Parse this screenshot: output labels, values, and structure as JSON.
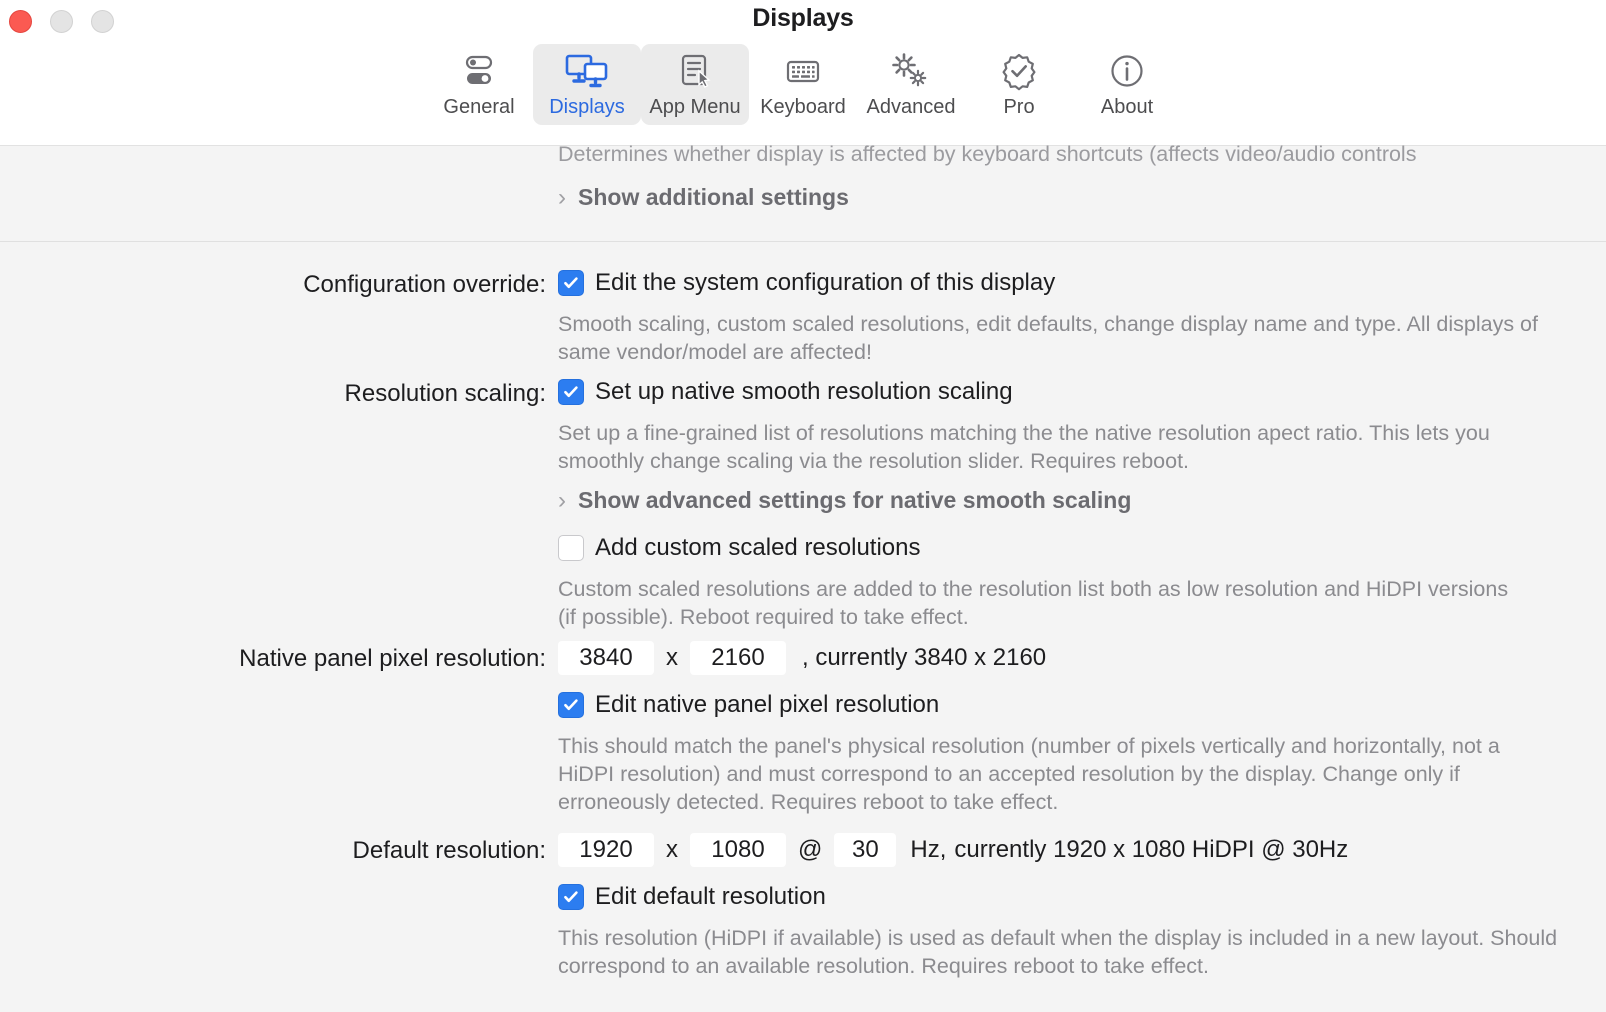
{
  "window": {
    "title": "Displays",
    "controls": [
      {
        "name": "close",
        "color": "#fb5a52"
      },
      {
        "name": "minimize",
        "color": "#e4e4e4"
      },
      {
        "name": "zoom",
        "color": "#e4e4e4"
      }
    ]
  },
  "toolbar": {
    "items": [
      {
        "label": "General",
        "icon": "toggles-icon",
        "state": "normal"
      },
      {
        "label": "Displays",
        "icon": "displays-icon",
        "state": "active"
      },
      {
        "label": "App Menu",
        "icon": "app-menu-icon",
        "state": "selected"
      },
      {
        "label": "Keyboard",
        "icon": "keyboard-icon",
        "state": "normal"
      },
      {
        "label": "Advanced",
        "icon": "gears-icon",
        "state": "normal"
      },
      {
        "label": "Pro",
        "icon": "badge-check-icon",
        "state": "normal"
      },
      {
        "label": "About",
        "icon": "info-circle-icon",
        "state": "normal"
      }
    ],
    "accent_color": "#2c6ae0",
    "selected_bg": "#ebebeb"
  },
  "content": {
    "clipped_description": "Determines whether display is affected by keyboard shortcuts (affects video/audio controls",
    "show_additional_settings": "Show additional settings",
    "chevron": "›",
    "configuration_override": {
      "label": "Configuration override:",
      "checkbox_label": "Edit the system configuration of this display",
      "checked": true,
      "help": "Smooth scaling, custom scaled resolutions, edit defaults, change display name and type. All displays of same vendor/model are affected!"
    },
    "resolution_scaling": {
      "label": "Resolution scaling:",
      "checkbox_label": "Set up native smooth resolution scaling",
      "checked": true,
      "help": "Set up a fine-grained list of resolutions matching the the native resolution apect ratio. This lets you smoothly change scaling via the resolution slider. Requires reboot.",
      "advanced_disclosure": "Show advanced settings for native smooth scaling"
    },
    "custom_scaled": {
      "checkbox_label": "Add custom scaled resolutions",
      "checked": false,
      "help": "Custom scaled resolutions are added to the resolution list both as low resolution and HiDPI versions (if possible). Reboot required to take effect."
    },
    "native_panel": {
      "label": "Native panel pixel resolution:",
      "width": "3840",
      "height": "2160",
      "separator": "x",
      "trailing": ", currently 3840 x 2160",
      "checkbox_label": "Edit native panel pixel resolution",
      "checked": true,
      "help": "This should match the panel's physical resolution (number of pixels vertically and horizontally, not a HiDPI resolution) and must correspond to an accepted resolution by the display. Change only if erroneously detected. Requires reboot to take effect."
    },
    "default_resolution": {
      "label": "Default resolution:",
      "width": "1920",
      "height": "1080",
      "refresh": "30",
      "separator": "x",
      "at_symbol": "@",
      "hz_unit": "Hz,",
      "trailing": "currently 1920 x 1080 HiDPI @ 30Hz",
      "checkbox_label": "Edit default resolution",
      "checked": true,
      "help": "This resolution (HiDPI if available) is used as default when the display is included in a new layout. Should correspond to an available resolution. Requires reboot to take effect."
    }
  }
}
